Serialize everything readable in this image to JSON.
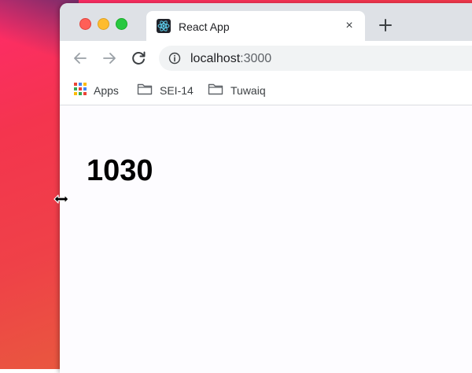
{
  "browser": {
    "tab": {
      "title": "React App",
      "favicon": "react-logo-icon",
      "close": "×"
    },
    "new_tab": "+",
    "address_bar": {
      "host": "localhost",
      "port": ":3000"
    },
    "bookmarks": [
      {
        "label": "Apps",
        "icon": "apps-grid-icon"
      },
      {
        "label": "SEI-14",
        "icon": "folder-icon"
      },
      {
        "label": "Tuwaiq",
        "icon": "folder-icon"
      }
    ]
  },
  "page": {
    "counter": "1030"
  },
  "colors": {
    "tab_bar": "#dee1e6",
    "react_blue": "#61dafb",
    "close": "#ff5f57",
    "minimize": "#febc2e",
    "maximize": "#28c840"
  },
  "cursor": "resize-horizontal-icon"
}
